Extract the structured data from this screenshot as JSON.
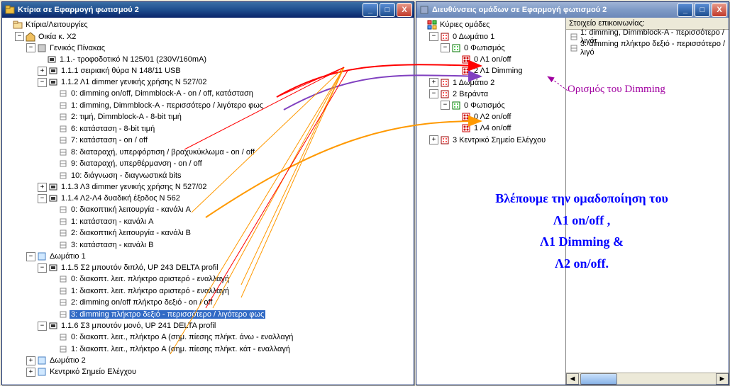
{
  "left_window": {
    "title": "Κτίρια σε Εφαρμογή φωτισμού 2",
    "root": "Κτίρια/Λειτουργίες",
    "house": "Οικία κ. Χ2",
    "board": "Γενικός Πίνακας",
    "n111": "1.1.- τροφοδοτικό N 125/01 (230V/160mA)",
    "n111b": "1.1.1 σειριακή θύρα N 148/11 USB",
    "n112": "1.1.2 Λ1 dimmer γενικής χρήσης N 527/02",
    "d0": "0: dimming on/off, Dimmblock-A - on / off, κατάσταση",
    "d1": "1: dimming, Dimmblock-A - περισσότερο / λιγότερο φως",
    "d2": "2: τιμή, Dimmblock-A - 8-bit τιμή",
    "d6": "6: κατάσταση - 8-bit τιμή",
    "d7": "7: κατάσταση - on / off",
    "d8": "8: διαταραχή, υπερφόρτιση / βραχυκύκλωμα - on / off",
    "d9": "9: διαταραχή, υπερθέρμανση - on / off",
    "d10": "10: διάγνωση - διαγνωστικά bits",
    "n113": "1.1.3 Λ3 dimmer γενικής χρήσης N 527/02",
    "n114": "1.1.4 Λ2-Λ4 δυαδική έξοδος N 562",
    "e0": "0: διακοπτική λειτουργία - κανάλι A",
    "e1": "1: κατάσταση - κανάλι A",
    "e2": "2: διακοπτική λειτουργία - κανάλι B",
    "e3": "3: κατάσταση - κανάλι B",
    "room1": "Δωμάτιο 1",
    "n115": "1.1.5 Σ2 μπουτόν διπλό, UP 243 DELTA profil",
    "b0": "0: διακοπτ. λειτ. πλήκτρο αριστερό - εναλλαγή",
    "b1": "1: διακοπτ. λειτ. πλήκτρο αριστερό - εναλλαγή",
    "b2": "2: dimming on/off πλήκτρο δεξιό - on / off",
    "b3": "3: dimming πλήκτρο δεξιό - περισσότερο / λιγότερο φως",
    "n116": "1.1.6 Σ3 μπουτόν μονό, UP 241 DELTA profil",
    "m0": "0: διακοπτ. λειτ., πλήκτρο A  (σημ. πίεσης πλήκτ. άνω - εναλλαγή",
    "m1": "1: διακοπτ. λειτ., πλήκτρο A  (σημ. πίεσης πλήκτ. κάτ - εναλλαγή",
    "room2": "Δωμάτιο 2",
    "central": "Κεντρικό Σημείο Ελέγχου"
  },
  "right_window": {
    "title": "Διευθύνσεις ομάδων σε Εφαρμογή φωτισμού 2",
    "root": "Κύριες ομάδες",
    "g0": "0 Δωμάτιο 1",
    "g0a": "0 Φωτισμός",
    "g0a0": "0 Λ1 on/off",
    "g0a2": "2 Λ1 Dimming",
    "g1": "1 Δωμάτιο 2",
    "g2": "2 Βεράντα",
    "g2a": "0 Φωτισμός",
    "g2a0": "0 Λ2 on/off",
    "g2a1": "1 Λ4 on/off",
    "g3": "3 Κεντρικό Σημείο Ελέγχου",
    "panel_header": "Στοιχείο επικοινωνίας:",
    "comm1": "1: dimming, Dimmblock-A - περισσότερο / λιγότ",
    "comm3": "3: dimming πλήκτρο δεξιό - περισσότερο / λιγό"
  },
  "annotations": {
    "dimming_def": "Ορισμός του Dimming",
    "grouping": "Βλέπουμε την ομαδοποίηση του\nΛ1 on/off ,\nΛ1 Dimming &\nΛ2 on/off."
  }
}
